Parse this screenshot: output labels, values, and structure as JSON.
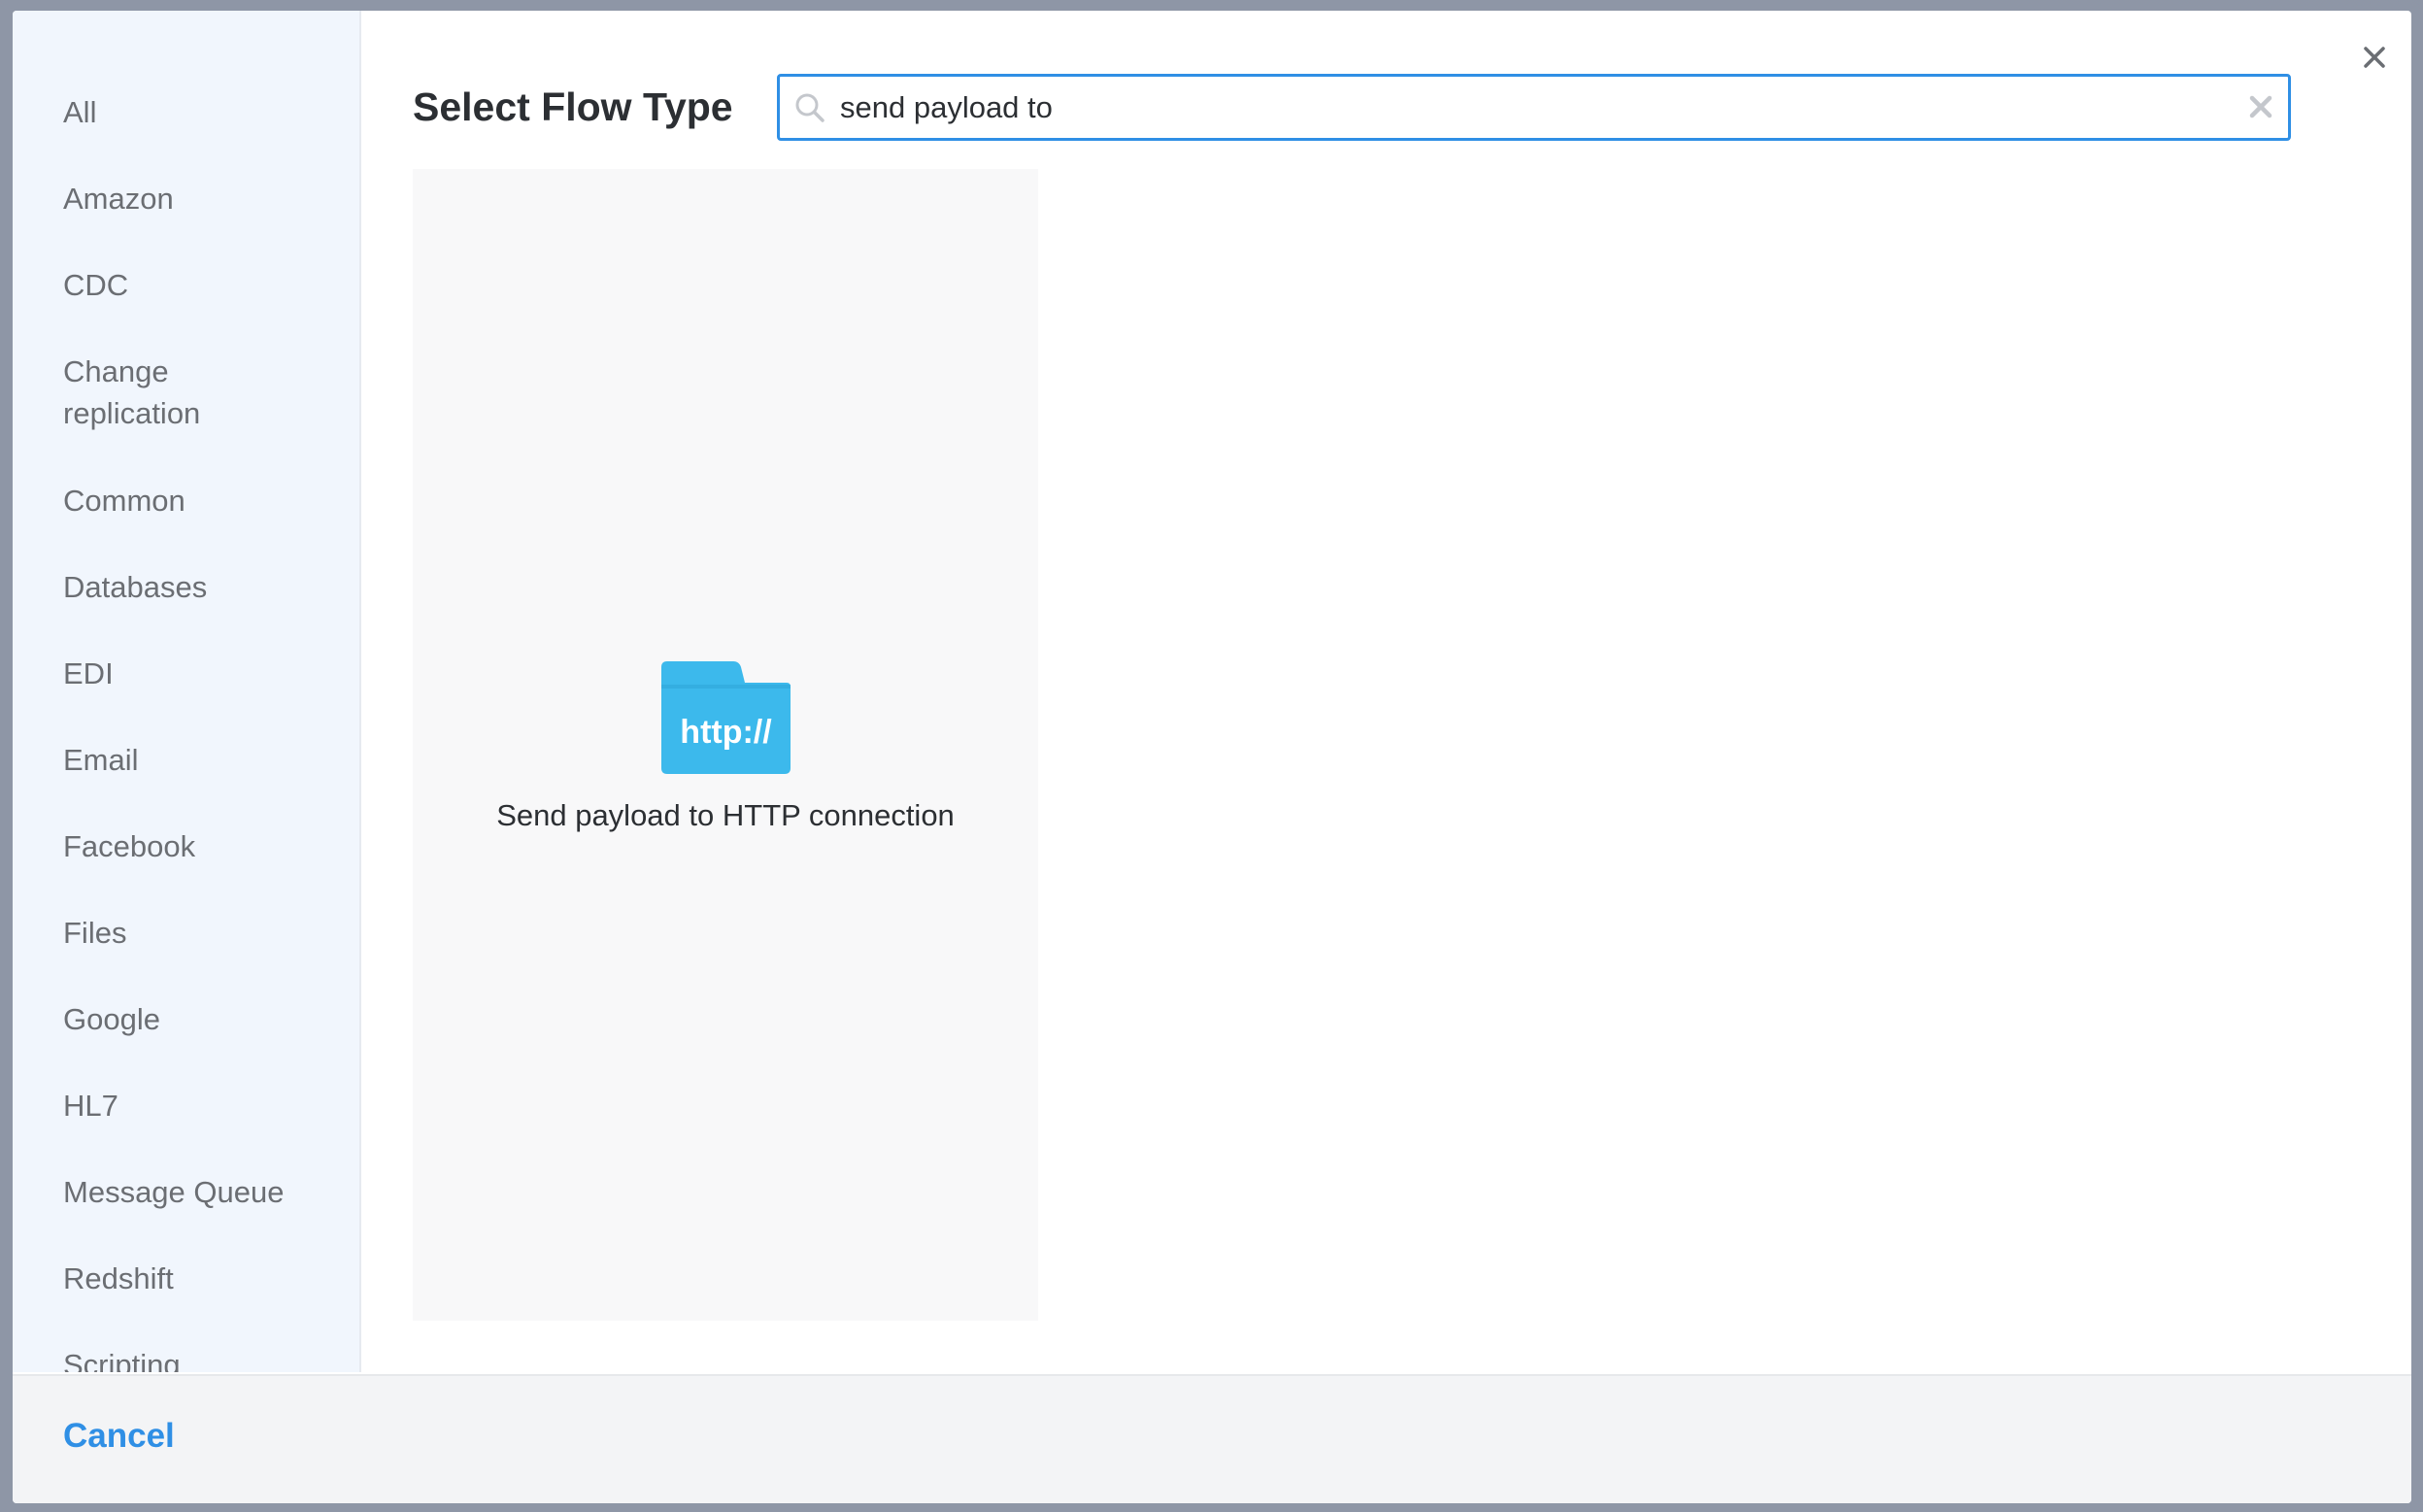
{
  "dialog": {
    "title": "Select Flow Type"
  },
  "search": {
    "value": "send payload to",
    "placeholder": ""
  },
  "sidebar": {
    "items": [
      {
        "label": "All"
      },
      {
        "label": "Amazon"
      },
      {
        "label": "CDC"
      },
      {
        "label": "Change replication"
      },
      {
        "label": "Common"
      },
      {
        "label": "Databases"
      },
      {
        "label": "EDI"
      },
      {
        "label": "Email"
      },
      {
        "label": "Facebook"
      },
      {
        "label": "Files"
      },
      {
        "label": "Google"
      },
      {
        "label": "HL7"
      },
      {
        "label": "Message Queue"
      },
      {
        "label": "Redshift"
      },
      {
        "label": "Scripting"
      }
    ]
  },
  "results": [
    {
      "label": "Send payload to HTTP connection",
      "icon": "http-folder-icon",
      "icon_text": "http://"
    }
  ],
  "footer": {
    "cancel_label": "Cancel"
  },
  "colors": {
    "accent": "#2f8fe5",
    "sidebar_bg": "#f1f6fd",
    "icon_blue": "#3cb9ec"
  }
}
